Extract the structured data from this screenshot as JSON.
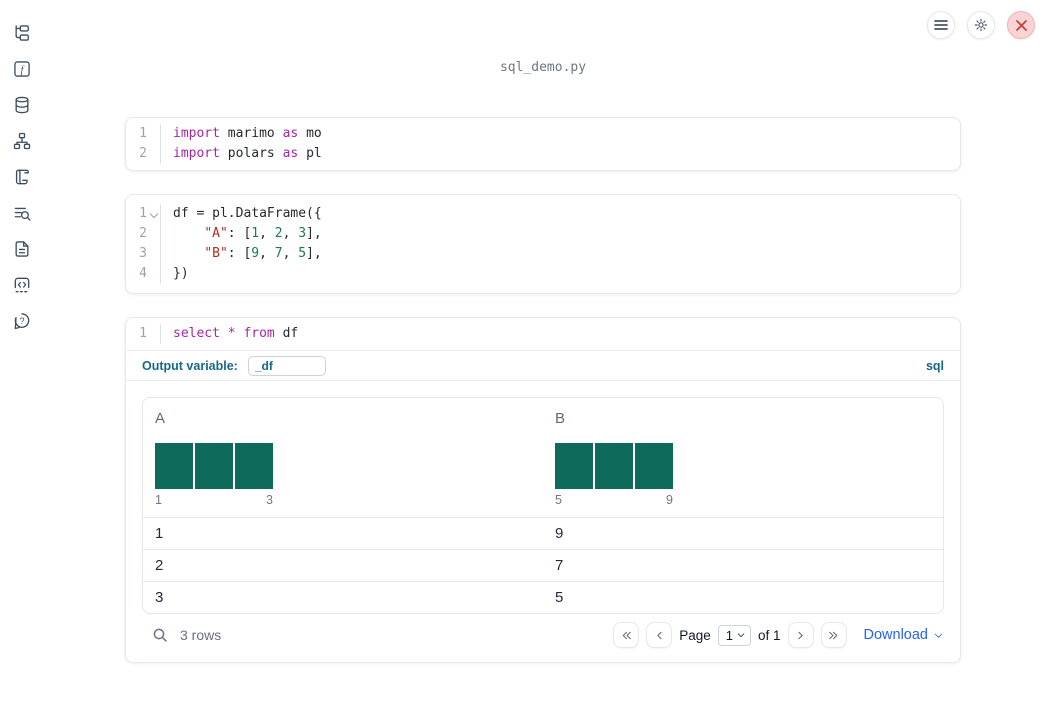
{
  "app": {
    "title": "sql_demo.py"
  },
  "topbar": {
    "buttons": [
      {
        "name": "notebook-menu"
      },
      {
        "name": "settings"
      },
      {
        "name": "shutdown"
      }
    ]
  },
  "sidebar": {
    "items": [
      {
        "name": "file-explorer"
      },
      {
        "name": "functions"
      },
      {
        "name": "data-sources"
      },
      {
        "name": "dependency-graph"
      },
      {
        "name": "logs"
      },
      {
        "name": "variable-explorer"
      },
      {
        "name": "documentation"
      },
      {
        "name": "snippets"
      },
      {
        "name": "help"
      }
    ]
  },
  "cells": [
    {
      "lines": [
        {
          "n": "1",
          "tokens": [
            {
              "t": "import",
              "c": "kw"
            },
            {
              "t": " marimo ",
              "c": "pl"
            },
            {
              "t": "as",
              "c": "kw"
            },
            {
              "t": " mo",
              "c": "pl"
            }
          ]
        },
        {
          "n": "2",
          "tokens": [
            {
              "t": "import",
              "c": "kw"
            },
            {
              "t": " polars ",
              "c": "pl"
            },
            {
              "t": "as",
              "c": "kw"
            },
            {
              "t": " pl",
              "c": "pl"
            }
          ]
        }
      ]
    },
    {
      "lines": [
        {
          "n": "1",
          "fold": true,
          "tokens": [
            {
              "t": "df = pl.DataFrame({",
              "c": "pl"
            }
          ]
        },
        {
          "n": "2",
          "tokens": [
            {
              "t": "    ",
              "c": "pl"
            },
            {
              "t": "\"A\"",
              "c": "str"
            },
            {
              "t": ": [",
              "c": "pl"
            },
            {
              "t": "1",
              "c": "num"
            },
            {
              "t": ", ",
              "c": "pl"
            },
            {
              "t": "2",
              "c": "num"
            },
            {
              "t": ", ",
              "c": "pl"
            },
            {
              "t": "3",
              "c": "num"
            },
            {
              "t": "],",
              "c": "pl"
            }
          ]
        },
        {
          "n": "3",
          "tokens": [
            {
              "t": "    ",
              "c": "pl"
            },
            {
              "t": "\"B\"",
              "c": "str"
            },
            {
              "t": ": [",
              "c": "pl"
            },
            {
              "t": "9",
              "c": "num"
            },
            {
              "t": ", ",
              "c": "pl"
            },
            {
              "t": "7",
              "c": "num"
            },
            {
              "t": ", ",
              "c": "pl"
            },
            {
              "t": "5",
              "c": "num"
            },
            {
              "t": "],",
              "c": "pl"
            }
          ]
        },
        {
          "n": "4",
          "tokens": [
            {
              "t": "})",
              "c": "pl"
            }
          ]
        }
      ]
    },
    {
      "lines": [
        {
          "n": "1",
          "tokens": [
            {
              "t": "select",
              "c": "kw"
            },
            {
              "t": " ",
              "c": "pl"
            },
            {
              "t": "*",
              "c": "kw"
            },
            {
              "t": " ",
              "c": "pl"
            },
            {
              "t": "from",
              "c": "kw"
            },
            {
              "t": " df",
              "c": "pl"
            }
          ]
        }
      ],
      "output_variable_label": "Output variable:",
      "output_variable_value": "_df",
      "language_badge": "sql"
    }
  ],
  "table": {
    "columns": [
      {
        "name": "A",
        "hist": {
          "values": [
            1,
            1,
            1
          ],
          "min": "1",
          "max": "3"
        }
      },
      {
        "name": "B",
        "hist": {
          "values": [
            1,
            1,
            1
          ],
          "min": "5",
          "max": "9"
        }
      }
    ],
    "rows": [
      [
        "1",
        "9"
      ],
      [
        "2",
        "7"
      ],
      [
        "3",
        "5"
      ]
    ],
    "footer": {
      "row_count": "3 rows",
      "page_label": "Page",
      "page_value": "1",
      "of_label": "of 1",
      "download_label": "Download"
    }
  },
  "colors": {
    "keyword": "#a626a4",
    "string": "#b02c20",
    "number": "#1e7a46",
    "code": "#24292e",
    "line-number": "#9aa3ad",
    "accent-blue": "#15688a",
    "link-blue": "#2563eb",
    "bar": "#0e6b5c",
    "icon": "#3f4d60",
    "danger": "#c53d3d"
  }
}
